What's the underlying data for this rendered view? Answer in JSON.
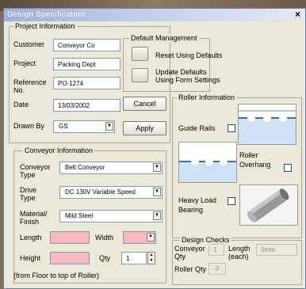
{
  "window": {
    "title": "Design Specification",
    "close_glyph": "×"
  },
  "project": {
    "legend": "Project Information",
    "customer_label": "Customer",
    "customer_value": "Conveyor Co",
    "project_label": "Project",
    "project_value": "Packing Dept",
    "reference_label_1": "Reference",
    "reference_label_2": "No.",
    "reference_value": "PO-1274",
    "date_label": "Date",
    "date_value": "13/03/2002",
    "drawnby_label": "Drawn By",
    "drawnby_value": "GS",
    "cancel_label": "Cancel",
    "apply_label": "Apply"
  },
  "defaults": {
    "legend": "Default Management",
    "reset_label": "Reset Using Defaults",
    "update_label_1": "Update Defaults",
    "update_label_2": "Using Form Settings"
  },
  "conveyor": {
    "legend": "Conveyor Information",
    "type_label_1": "Conveyor",
    "type_label_2": "Type",
    "type_value": "Belt Conveyor",
    "drive_label_1": "Drive",
    "drive_label_2": "Type",
    "drive_value": "DC 130V Variable Speed",
    "material_label_1": "Material/",
    "material_label_2": "Finish",
    "material_value": "Mild Steel",
    "length_label": "Length",
    "width_label": "Width",
    "height_label": "Height",
    "qty_label": "Qty",
    "qty_value": "1",
    "footnote": "(from Floor to top of Roller)"
  },
  "roller": {
    "legend": "Roller Information",
    "guide_rails_label": "Guide Rails",
    "overhang_label_1": "Roller",
    "overhang_label_2": "Overhang",
    "heavy_label_1": "Heavy Load",
    "heavy_label_2": "Bearing"
  },
  "checks": {
    "legend": "Design Checks",
    "conveyor_qty_label_1": "Conveyor",
    "conveyor_qty_label_2": "Qty",
    "conveyor_qty_value": "1",
    "length_each_label_1": "Length",
    "length_each_label_2": "(each)",
    "length_each_value": "0mm",
    "roller_qty_label": "Roller Qty",
    "roller_qty_value": "-3"
  },
  "colors": {
    "pink_field": "#f7b9be",
    "title_bar": "#9fb1dd",
    "dialog_bg": "#ece9d8"
  }
}
